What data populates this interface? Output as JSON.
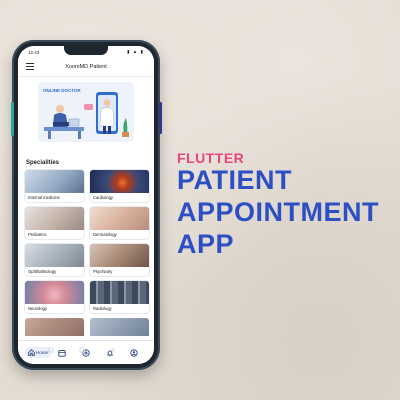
{
  "status_bar": {
    "time": "12:43",
    "icons": "▮ ▲ ▮"
  },
  "app_bar": {
    "title": "XoomMD Patient"
  },
  "banner": {
    "label": "ONLINE DOCTOR"
  },
  "specialities": {
    "title": "Specialities",
    "items": [
      {
        "label": "Internal medicine"
      },
      {
        "label": "Cardiology"
      },
      {
        "label": "Pediatrics"
      },
      {
        "label": "Dermatology"
      },
      {
        "label": "Ophthalmology"
      },
      {
        "label": "Psychiatry"
      },
      {
        "label": "Neurology"
      },
      {
        "label": "Radiology"
      }
    ]
  },
  "bottom_nav": {
    "home_label": "Home"
  },
  "headline": {
    "kicker": "FLUTTER",
    "line1": "PATIENT",
    "line2": "APPOINTMENT",
    "line3": "APP"
  },
  "colors": {
    "accent_pink": "#e8467a",
    "accent_blue": "#2c4fc4",
    "banner_blue": "#2e6fd6"
  }
}
